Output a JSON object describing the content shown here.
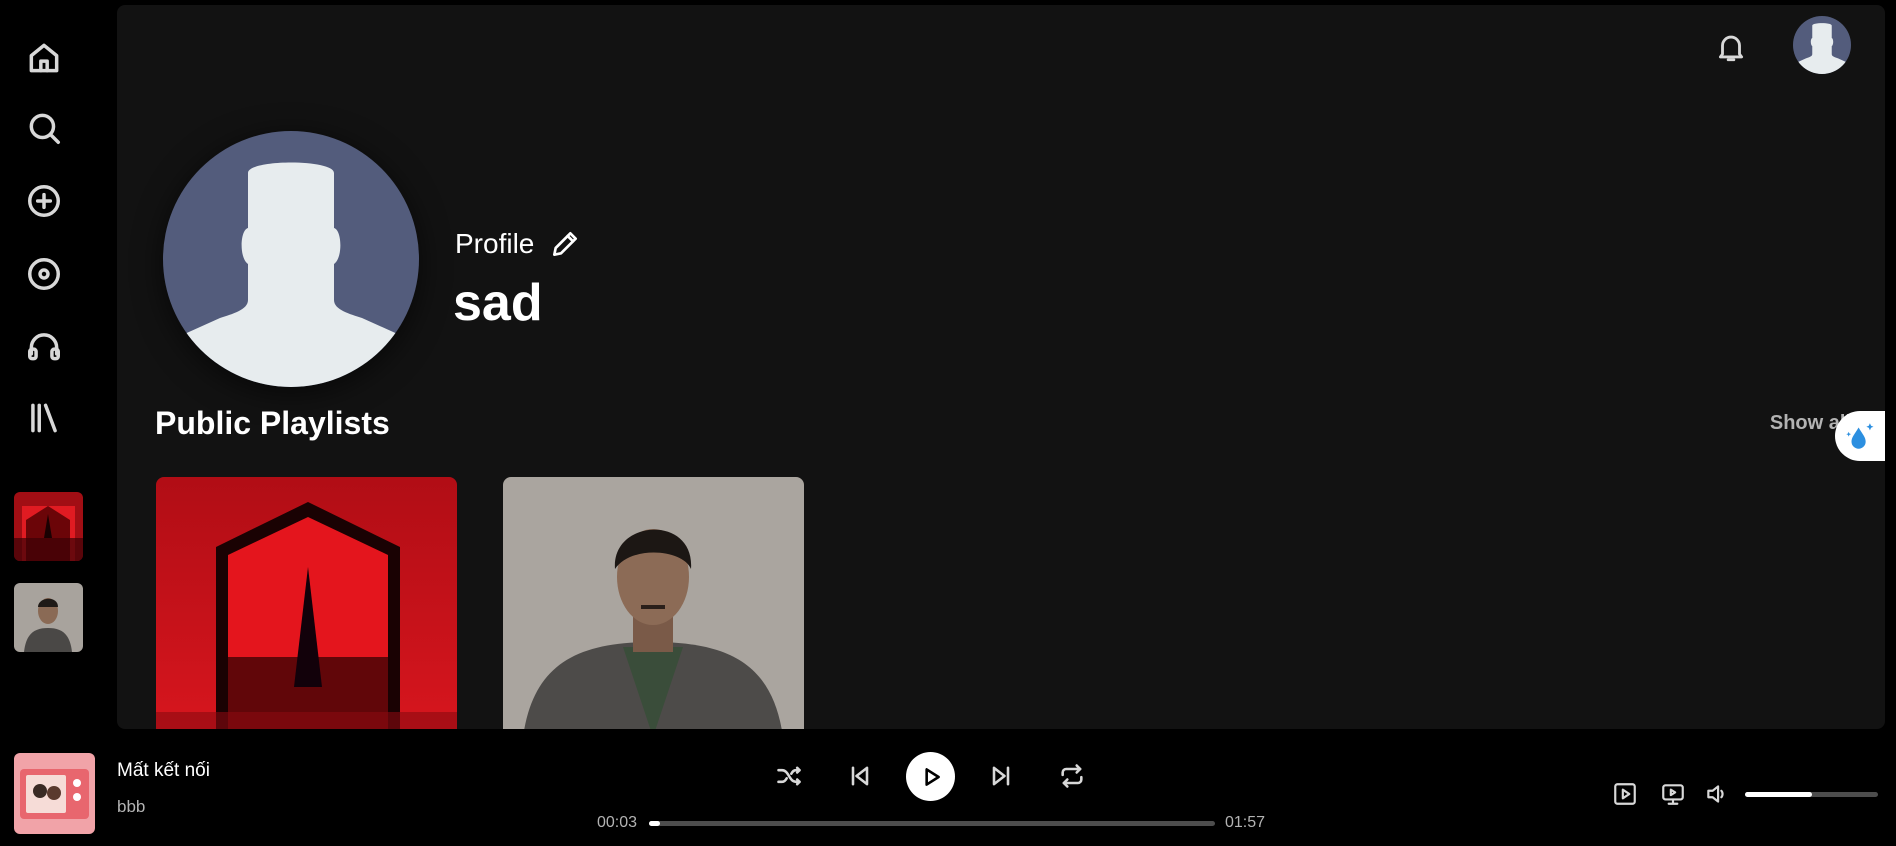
{
  "sidebar": {
    "icons": [
      "home-icon",
      "search-icon",
      "add-circle-icon",
      "disc-icon",
      "headphones-icon",
      "library-icon"
    ]
  },
  "header": {
    "icons": [
      "bell-icon",
      "user-avatar"
    ]
  },
  "profile": {
    "label": "Profile",
    "name": "sad"
  },
  "section": {
    "title": "Public Playlists",
    "show_all": "Show all"
  },
  "player": {
    "track_title": "Mất kết nối",
    "artist": "bbb",
    "elapsed": "00:03",
    "duration": "01:57",
    "progress": 0.02,
    "volume": 0.5
  },
  "colors": {
    "background": "#000000",
    "main_bg": "#121212",
    "avatar_bg": "#535c7c",
    "avatar_figure": "#e7ecee",
    "text_secondary": "#b3b3b3"
  }
}
